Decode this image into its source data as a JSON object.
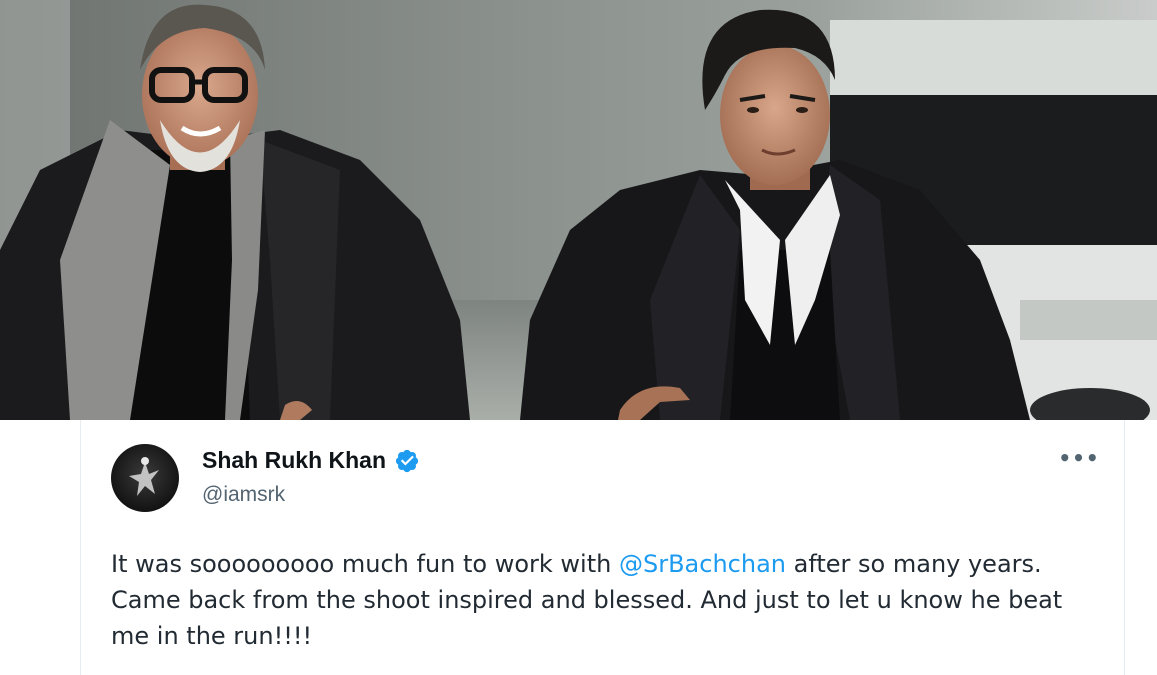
{
  "photo": {
    "description_icon": "photo-of-two-men-running"
  },
  "tweet": {
    "avatar_icon": "profile-avatar",
    "display_name": "Shah Rukh Khan",
    "verified_icon": "verified-badge-icon",
    "handle": "@iamsrk",
    "more_icon": "more-options-icon",
    "more_label": "•••",
    "text_before_mention": "It was sooooooooo much fun to work with ",
    "mention": "@SrBachchan",
    "text_after_mention": " after so many years. Came back from the shoot inspired and blessed. And just to let u know he beat me in the run!!!!"
  },
  "colors": {
    "accent": "#1d9bf0",
    "text": "#0f1419",
    "muted": "#536471"
  }
}
